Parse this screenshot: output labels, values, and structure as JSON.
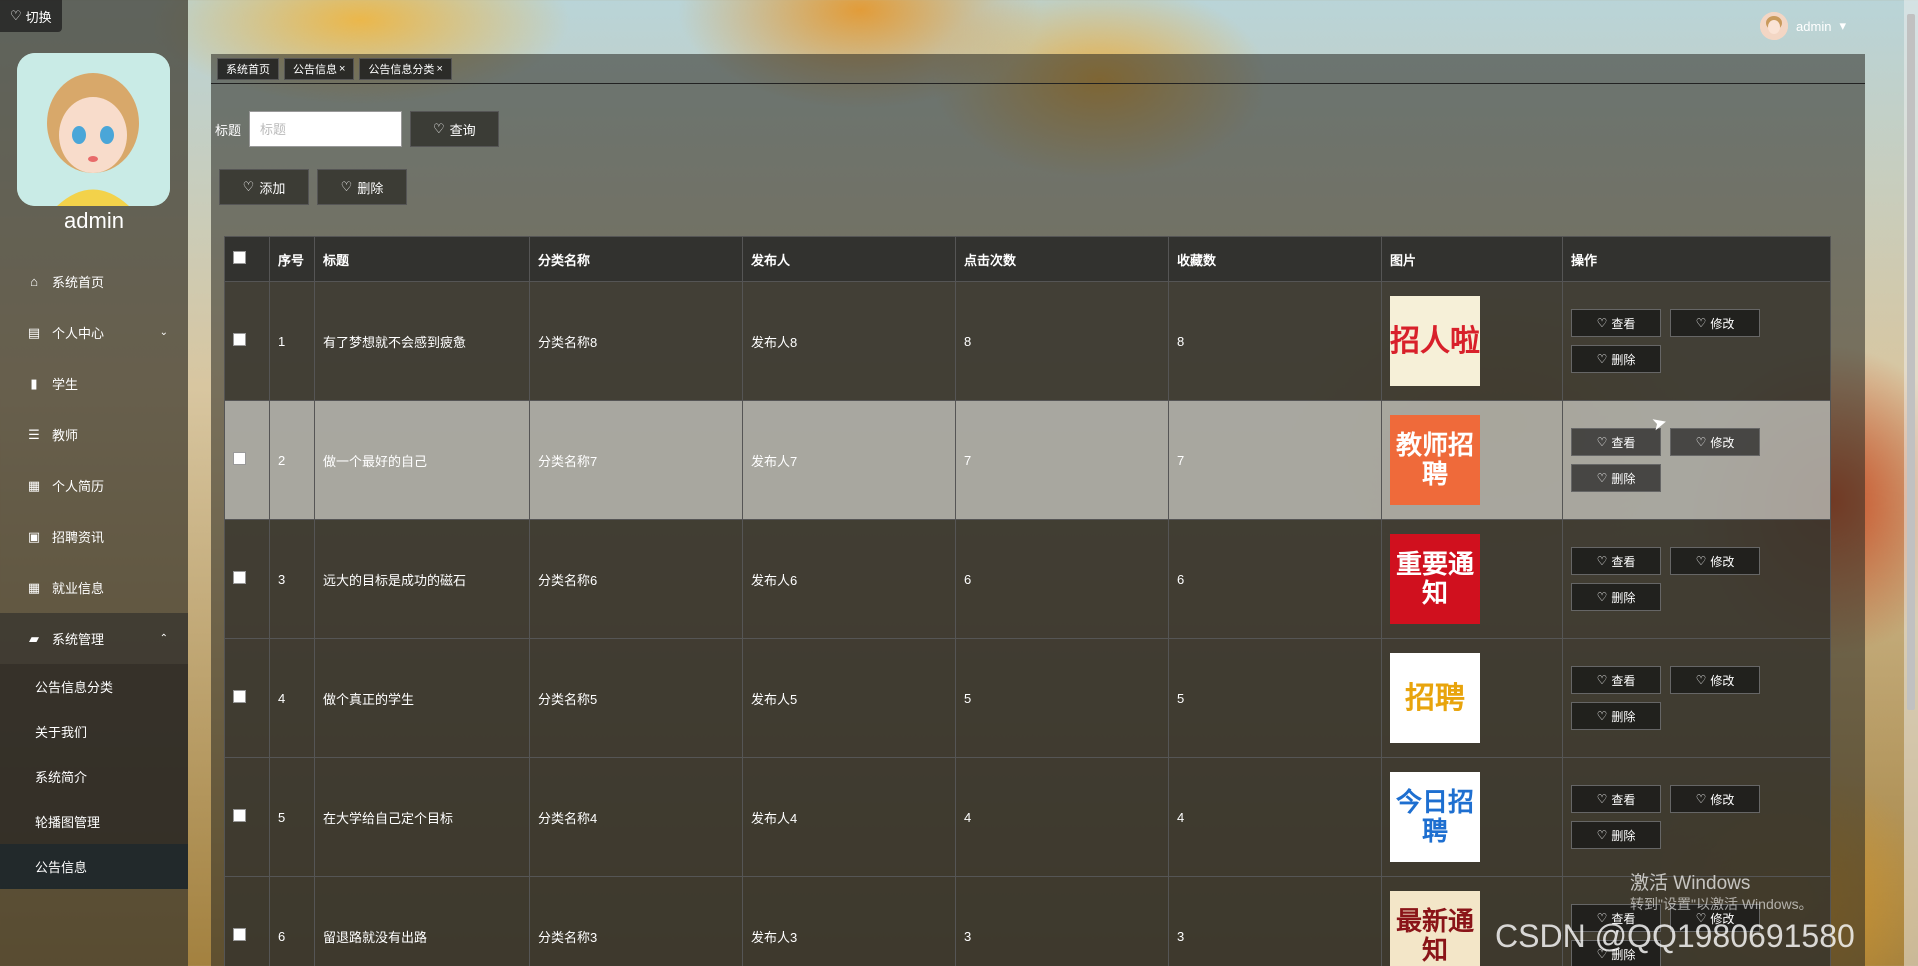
{
  "sidebar": {
    "switch_label": "切换",
    "admin_name": "admin",
    "menu": [
      {
        "label": "系统首页",
        "icon": "home-icon"
      },
      {
        "label": "个人中心",
        "icon": "user-center-icon"
      },
      {
        "label": "学生",
        "icon": "clipboard-icon"
      },
      {
        "label": "教师",
        "icon": "sliders-icon"
      },
      {
        "label": "个人简历",
        "icon": "grid-icon"
      },
      {
        "label": "招聘资讯",
        "icon": "chart-icon"
      },
      {
        "label": "就业信息",
        "icon": "grid-icon"
      },
      {
        "label": "系统管理",
        "icon": "briefcase-icon"
      }
    ],
    "submenu": [
      {
        "label": "公告信息分类"
      },
      {
        "label": "关于我们"
      },
      {
        "label": "系统简介"
      },
      {
        "label": "轮播图管理"
      },
      {
        "label": "公告信息"
      }
    ]
  },
  "topbar": {
    "user": "admin"
  },
  "tabs": [
    {
      "label": "系统首页",
      "closable": false
    },
    {
      "label": "公告信息",
      "closable": true
    },
    {
      "label": "公告信息分类",
      "closable": true
    }
  ],
  "search": {
    "label": "标题",
    "placeholder": "标题",
    "button": "查询"
  },
  "actions": {
    "add": "添加",
    "delete": "删除"
  },
  "table": {
    "headers": [
      "序号",
      "标题",
      "分类名称",
      "发布人",
      "点击次数",
      "收藏数",
      "图片",
      "操作"
    ],
    "rows": [
      {
        "no": "1",
        "title": "有了梦想就不会感到疲惫",
        "category": "分类名称8",
        "publisher": "发布人8",
        "clicks": "8",
        "favorites": "8",
        "image_text": "招人啦",
        "image_colors": [
          "#f6f0d8",
          "#d8202a"
        ]
      },
      {
        "no": "2",
        "title": "做一个最好的自己",
        "category": "分类名称7",
        "publisher": "发布人7",
        "clicks": "7",
        "favorites": "7",
        "image_text": "教师招聘",
        "image_colors": [
          "#ef6a3a",
          "#ffffff"
        ]
      },
      {
        "no": "3",
        "title": "远大的目标是成功的磁石",
        "category": "分类名称6",
        "publisher": "发布人6",
        "clicks": "6",
        "favorites": "6",
        "image_text": "重要通知",
        "image_colors": [
          "#d0101e",
          "#ffffff"
        ]
      },
      {
        "no": "4",
        "title": "做个真正的学生",
        "category": "分类名称5",
        "publisher": "发布人5",
        "clicks": "5",
        "favorites": "5",
        "image_text": "招聘",
        "image_colors": [
          "#ffffff",
          "#e8a40c"
        ]
      },
      {
        "no": "5",
        "title": "在大学给自己定个目标",
        "category": "分类名称4",
        "publisher": "发布人4",
        "clicks": "4",
        "favorites": "4",
        "image_text": "今日招聘",
        "image_colors": [
          "#ffffff",
          "#1e6fd0"
        ]
      },
      {
        "no": "6",
        "title": "留退路就没有出路",
        "category": "分类名称3",
        "publisher": "发布人3",
        "clicks": "3",
        "favorites": "3",
        "image_text": "最新通知",
        "image_colors": [
          "#f3e6c8",
          "#8a1418"
        ]
      }
    ],
    "row_actions": {
      "view": "查看",
      "edit": "修改",
      "delete": "删除"
    }
  },
  "watermark": {
    "line1": "激活 Windows",
    "line2": "转到\"设置\"以激活 Windows。"
  },
  "csdn_text": "CSDN @QQ1980691580"
}
